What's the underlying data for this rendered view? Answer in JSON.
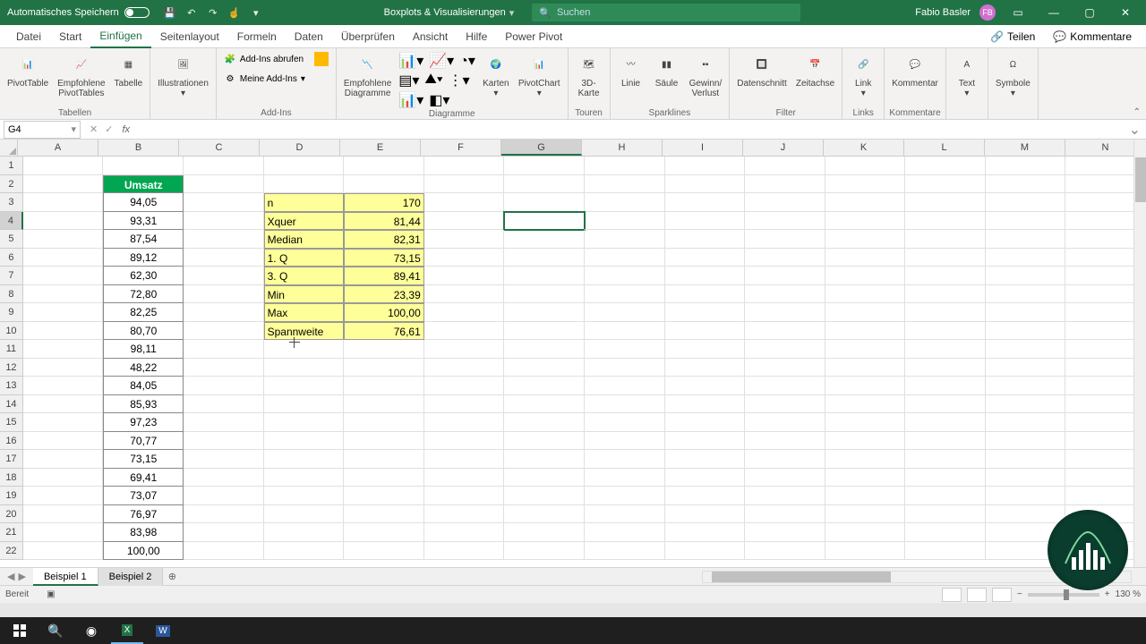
{
  "titlebar": {
    "autosave": "Automatisches Speichern",
    "doc_title": "Boxplots & Visualisierungen",
    "search_placeholder": "Suchen",
    "user_name": "Fabio Basler",
    "user_initials": "FB"
  },
  "menu": {
    "tabs": [
      "Datei",
      "Start",
      "Einfügen",
      "Seitenlayout",
      "Formeln",
      "Daten",
      "Überprüfen",
      "Ansicht",
      "Hilfe",
      "Power Pivot"
    ],
    "active": "Einfügen",
    "share": "Teilen",
    "comments": "Kommentare"
  },
  "ribbon": {
    "groups": {
      "tables": {
        "label": "Tabellen",
        "pivot": "PivotTable",
        "rec": "Empfohlene\nPivotTables",
        "table": "Tabelle"
      },
      "illus": {
        "label": "",
        "btn": "Illustrationen"
      },
      "addins": {
        "label": "Add-Ins",
        "get": "Add-Ins abrufen",
        "my": "Meine Add-Ins"
      },
      "charts": {
        "label": "Diagramme",
        "rec": "Empfohlene\nDiagramme",
        "maps": "Karten",
        "pivot": "PivotChart"
      },
      "tours": {
        "label": "Touren",
        "btn": "3D-\nKarte"
      },
      "spark": {
        "label": "Sparklines",
        "line": "Linie",
        "col": "Säule",
        "wl": "Gewinn/\nVerlust"
      },
      "filter": {
        "label": "Filter",
        "slicer": "Datenschnitt",
        "timeline": "Zeitachse"
      },
      "links": {
        "label": "Links",
        "btn": "Link"
      },
      "comments": {
        "label": "Kommentare",
        "btn": "Kommentar"
      },
      "text": {
        "label": "",
        "btn": "Text"
      },
      "symbols": {
        "label": "",
        "btn": "Symbole"
      }
    }
  },
  "namebox": "G4",
  "columns": [
    "A",
    "B",
    "C",
    "D",
    "E",
    "F",
    "G",
    "H",
    "I",
    "J",
    "K",
    "L",
    "M",
    "N"
  ],
  "selected_col": "G",
  "selected_row": 4,
  "umsatz_header": "Umsatz",
  "umsatz": [
    "94,05",
    "93,31",
    "87,54",
    "89,12",
    "62,30",
    "72,80",
    "82,25",
    "80,70",
    "98,11",
    "48,22",
    "84,05",
    "85,93",
    "97,23",
    "70,77",
    "73,15",
    "69,41",
    "73,07",
    "76,97",
    "83,98",
    "100,00"
  ],
  "stats": [
    {
      "label": "n",
      "val": "170"
    },
    {
      "label": "Xquer",
      "val": "81,44"
    },
    {
      "label": "Median",
      "val": "82,31"
    },
    {
      "label": "1. Q",
      "val": "73,15"
    },
    {
      "label": "3. Q",
      "val": "89,41"
    },
    {
      "label": "Min",
      "val": "23,39"
    },
    {
      "label": "Max",
      "val": "100,00"
    },
    {
      "label": "Spannweite",
      "val": "76,61"
    }
  ],
  "sheets": {
    "tabs": [
      "Beispiel 1",
      "Beispiel 2"
    ],
    "active": "Beispiel 1"
  },
  "status": {
    "ready": "Bereit",
    "zoom": "130 %"
  }
}
